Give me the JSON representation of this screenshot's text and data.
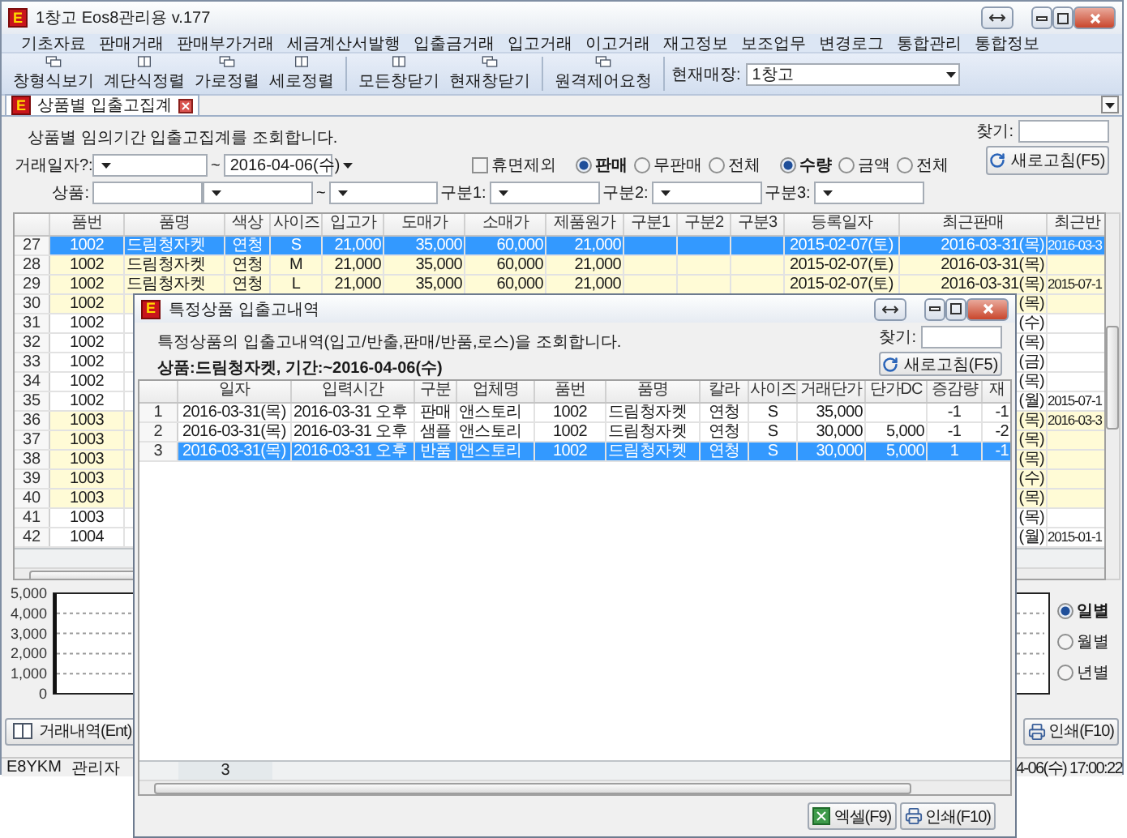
{
  "window": {
    "logo": "E",
    "title": "1창고 Eos8관리용 v.177"
  },
  "menu": [
    "기초자료",
    "판매거래",
    "판매부가거래",
    "세금계산서발행",
    "입출금거래",
    "입고거래",
    "이고거래",
    "재고정보",
    "보조업무",
    "변경로그",
    "통합관리",
    "통합정보"
  ],
  "toolbar": {
    "groups": [
      [
        "창형식보기",
        "계단식정렬",
        "가로정렬",
        "세로정렬"
      ],
      [
        "모든창닫기",
        "현재창닫기"
      ],
      [
        "원격제어요청"
      ]
    ],
    "store_label": "현재매장:",
    "store_value": "1창고"
  },
  "tabs": [
    {
      "logo": "E",
      "label": "상품별 입출고집계",
      "selected": true
    }
  ],
  "form": {
    "description": "상품별 임의기간 입출고집계를 조회합니다.",
    "find_label": "찾기:",
    "date_label": "거래일자?:",
    "tilde": "~",
    "date_to": "2016-04-06(수)",
    "product_label": "상품:",
    "dormant": {
      "label": "휴면제외",
      "checked": false
    },
    "sale_filter": [
      {
        "label": "판매",
        "selected": true
      },
      {
        "label": "무판매",
        "selected": false
      },
      {
        "label": "전체",
        "selected": false
      }
    ],
    "unit_filter": [
      {
        "label": "수량",
        "selected": true
      },
      {
        "label": "금액",
        "selected": false
      },
      {
        "label": "전체",
        "selected": false
      }
    ],
    "category_labels": [
      "구분1:",
      "구분2:",
      "구분3:"
    ],
    "refresh": "새로고침(F5)"
  },
  "grid": {
    "columns": [
      "품번",
      "품명",
      "색상",
      "사이즈",
      "입고가",
      "도매가",
      "소매가",
      "제품원가",
      "구분1",
      "구분2",
      "구분3",
      "등록일자",
      "최근판매",
      "최근반"
    ],
    "rows": [
      {
        "no": "27",
        "selected": true,
        "cells": [
          "1002",
          "드림청자켓",
          "연청",
          "S",
          "21,000",
          "35,000",
          "60,000",
          "21,000",
          null,
          null,
          null,
          "2015-02-07(토)",
          "2016-03-31(목)",
          "2016-03-3"
        ]
      },
      {
        "no": "28",
        "selected": false,
        "highlighted": true,
        "cells": [
          "1002",
          "드림청자켓",
          "연청",
          "M",
          "21,000",
          "35,000",
          "60,000",
          "21,000",
          null,
          null,
          null,
          "2015-02-07(토)",
          "2016-03-31(목)",
          null
        ]
      },
      {
        "no": "29",
        "selected": false,
        "highlighted": true,
        "cells": [
          "1002",
          "드림청자켓",
          "연청",
          "L",
          "21,000",
          "35,000",
          "60,000",
          "21,000",
          null,
          null,
          null,
          "2015-02-07(토)",
          "2016-03-31(목)",
          "2015-07-1"
        ]
      },
      {
        "no": "30",
        "selected": false,
        "highlighted": true,
        "cells": [
          "1002",
          null,
          null,
          null,
          null,
          null,
          null,
          null,
          null,
          null,
          null,
          null,
          "(목)",
          null
        ]
      },
      {
        "no": "31",
        "selected": false,
        "highlighted": false,
        "cells": [
          "1002",
          null,
          null,
          null,
          null,
          null,
          null,
          null,
          null,
          null,
          null,
          null,
          "(수)",
          null
        ]
      },
      {
        "no": "32",
        "selected": false,
        "highlighted": false,
        "cells": [
          "1002",
          null,
          null,
          null,
          null,
          null,
          null,
          null,
          null,
          null,
          null,
          null,
          "(목)",
          null
        ]
      },
      {
        "no": "33",
        "selected": false,
        "highlighted": false,
        "cells": [
          "1002",
          null,
          null,
          null,
          null,
          null,
          null,
          null,
          null,
          null,
          null,
          null,
          "(금)",
          null
        ]
      },
      {
        "no": "34",
        "selected": false,
        "highlighted": false,
        "cells": [
          "1002",
          null,
          null,
          null,
          null,
          null,
          null,
          null,
          null,
          null,
          null,
          null,
          "(목)",
          null
        ]
      },
      {
        "no": "35",
        "selected": false,
        "highlighted": false,
        "cells": [
          "1002",
          null,
          null,
          null,
          null,
          null,
          null,
          null,
          null,
          null,
          null,
          null,
          "(월)",
          "2015-07-1"
        ]
      },
      {
        "no": "36",
        "selected": false,
        "highlighted": true,
        "cells": [
          "1003",
          null,
          null,
          null,
          null,
          null,
          null,
          null,
          null,
          null,
          null,
          null,
          "(목)",
          "2016-03-3"
        ]
      },
      {
        "no": "37",
        "selected": false,
        "highlighted": true,
        "cells": [
          "1003",
          null,
          null,
          null,
          null,
          null,
          null,
          null,
          null,
          null,
          null,
          null,
          "(목)",
          null
        ]
      },
      {
        "no": "38",
        "selected": false,
        "highlighted": true,
        "cells": [
          "1003",
          null,
          null,
          null,
          null,
          null,
          null,
          null,
          null,
          null,
          null,
          null,
          "(목)",
          null
        ]
      },
      {
        "no": "39",
        "selected": false,
        "highlighted": true,
        "cells": [
          "1003",
          null,
          null,
          null,
          null,
          null,
          null,
          null,
          null,
          null,
          null,
          null,
          "(수)",
          null
        ]
      },
      {
        "no": "40",
        "selected": false,
        "highlighted": true,
        "cells": [
          "1003",
          null,
          null,
          null,
          null,
          null,
          null,
          null,
          null,
          null,
          null,
          null,
          "(목)",
          null
        ]
      },
      {
        "no": "41",
        "selected": false,
        "highlighted": false,
        "cells": [
          "1003",
          null,
          null,
          null,
          null,
          null,
          null,
          null,
          null,
          null,
          null,
          null,
          "(목)",
          null
        ]
      },
      {
        "no": "42",
        "selected": false,
        "highlighted": false,
        "cells": [
          "1004",
          null,
          null,
          null,
          null,
          null,
          null,
          null,
          null,
          null,
          null,
          null,
          "(월)",
          "2015-01-1"
        ]
      }
    ]
  },
  "chart": {
    "y_axis_labels": [
      "5,000",
      "4,000",
      "3,000",
      "2,000",
      "1,000",
      "0"
    ]
  },
  "period_options": [
    {
      "label": "일별",
      "selected": true
    },
    {
      "label": "월별",
      "selected": false
    },
    {
      "label": "년별",
      "selected": false
    }
  ],
  "buttons": [
    {
      "kind": "history",
      "label": "거래내역(Ent)"
    },
    {
      "kind": "print",
      "label": "인쇄(F10)"
    }
  ],
  "status_bar": {
    "code": "E8YKM",
    "user": "관리자",
    "time": "4-06(수) 17:00:22"
  },
  "dialog": {
    "logo": "E",
    "title": "특정상품 입출고내역",
    "description": "특정상품의 입출고내역(입고/반출,판매/반품,로스)을 조회합니다.",
    "summary": "상품:드림청자켓, 기간:~2016-04-06(수)",
    "find_label": "찾기:",
    "refresh": "새로고침(F5)",
    "columns": [
      "일자",
      "입력시간",
      "구분",
      "업체명",
      "품번",
      "품명",
      "칼라",
      "사이즈",
      "거래단가",
      "단가DC",
      "증감량",
      "재"
    ],
    "rows": [
      {
        "no": "1",
        "selected": false,
        "cells": [
          "2016-03-31(목)",
          "2016-03-31 오후",
          "판매",
          "앤스토리",
          "1002",
          "드림청자켓",
          "연청",
          "S",
          "35,000",
          null,
          "-1",
          "-1"
        ]
      },
      {
        "no": "2",
        "selected": false,
        "cells": [
          "2016-03-31(목)",
          "2016-03-31 오후",
          "샘플",
          "앤스토리",
          "1002",
          "드림청자켓",
          "연청",
          "S",
          "30,000",
          "5,000",
          "-1",
          "-2"
        ]
      },
      {
        "no": "3",
        "selected": true,
        "cells": [
          "2016-03-31(목)",
          "2016-03-31 오후",
          "반품",
          "앤스토리",
          "1002",
          "드림청자켓",
          "연청",
          "S",
          "30,000",
          "5,000",
          "1",
          "-1"
        ]
      }
    ],
    "count": "3",
    "buttons": [
      {
        "kind": "excel",
        "label": "엑셀(F9)"
      },
      {
        "kind": "print",
        "label": "인쇄(F10)"
      }
    ]
  }
}
